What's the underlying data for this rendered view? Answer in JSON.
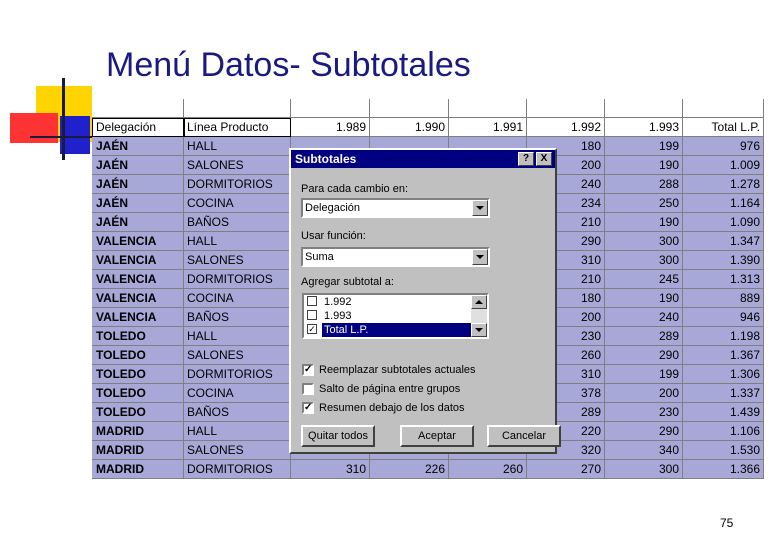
{
  "slide": {
    "title": "Menú Datos- Subtotales",
    "page_number": "75"
  },
  "sheet": {
    "headers": [
      "Delegación",
      "Línea Producto",
      "1.989",
      "1.990",
      "1.991",
      "1.992",
      "1.993",
      "Total L.P."
    ],
    "rows": [
      [
        "JAÉN",
        "HALL",
        "",
        "",
        "",
        "180",
        "199",
        "976"
      ],
      [
        "JAÉN",
        "SALONES",
        "",
        "",
        "",
        "200",
        "190",
        "1.009"
      ],
      [
        "JAÉN",
        "DORMITORIOS",
        "",
        "",
        "",
        "240",
        "288",
        "1.278"
      ],
      [
        "JAÉN",
        "COCINA",
        "",
        "",
        "",
        "234",
        "250",
        "1.164"
      ],
      [
        "JAÉN",
        "BAÑOS",
        "",
        "",
        "",
        "210",
        "190",
        "1.090"
      ],
      [
        "VALENCIA",
        "HALL",
        "",
        "",
        "",
        "290",
        "300",
        "1.347"
      ],
      [
        "VALENCIA",
        "SALONES",
        "",
        "",
        "",
        "310",
        "300",
        "1.390"
      ],
      [
        "VALENCIA",
        "DORMITORIOS",
        "",
        "",
        "",
        "210",
        "245",
        "1.313"
      ],
      [
        "VALENCIA",
        "COCINA",
        "",
        "",
        "",
        "180",
        "190",
        "889"
      ],
      [
        "VALENCIA",
        "BAÑOS",
        "",
        "",
        "",
        "200",
        "240",
        "946"
      ],
      [
        "TOLEDO",
        "HALL",
        "",
        "",
        "",
        "230",
        "289",
        "1.198"
      ],
      [
        "TOLEDO",
        "SALONES",
        "",
        "",
        "",
        "260",
        "290",
        "1.367"
      ],
      [
        "TOLEDO",
        "DORMITORIOS",
        "",
        "",
        "",
        "310",
        "199",
        "1.306"
      ],
      [
        "TOLEDO",
        "COCINA",
        "",
        "",
        "",
        "378",
        "200",
        "1.337"
      ],
      [
        "TOLEDO",
        "BAÑOS",
        "",
        "",
        "",
        "289",
        "230",
        "1.439"
      ],
      [
        "MADRID",
        "HALL",
        "",
        "",
        "",
        "220",
        "290",
        "1.106"
      ],
      [
        "MADRID",
        "SALONES",
        "",
        "",
        "",
        "320",
        "340",
        "1.530"
      ],
      [
        "MADRID",
        "DORMITORIOS",
        "310",
        "226",
        "260",
        "270",
        "300",
        "1.366"
      ]
    ]
  },
  "dialog": {
    "title": "Subtotales",
    "help_label": "?",
    "close_label": "X",
    "change_label": "Para cada cambio en:",
    "change_value": "Delegación",
    "function_label": "Usar función:",
    "function_value": "Suma",
    "add_label": "Agregar subtotal a:",
    "list_items": [
      {
        "label": "1.992",
        "checked": false
      },
      {
        "label": "1.993",
        "checked": false
      },
      {
        "label": "Total L.P.",
        "checked": true
      }
    ],
    "replace_label": "Reemplazar subtotales actuales",
    "pagebreak_label": "Salto de página entre grupos",
    "summary_label": "Resumen debajo de los datos",
    "replace_checked": true,
    "pagebreak_checked": false,
    "summary_checked": true,
    "remove_all_label": "Quitar todos",
    "ok_label": "Aceptar",
    "cancel_label": "Cancelar"
  }
}
